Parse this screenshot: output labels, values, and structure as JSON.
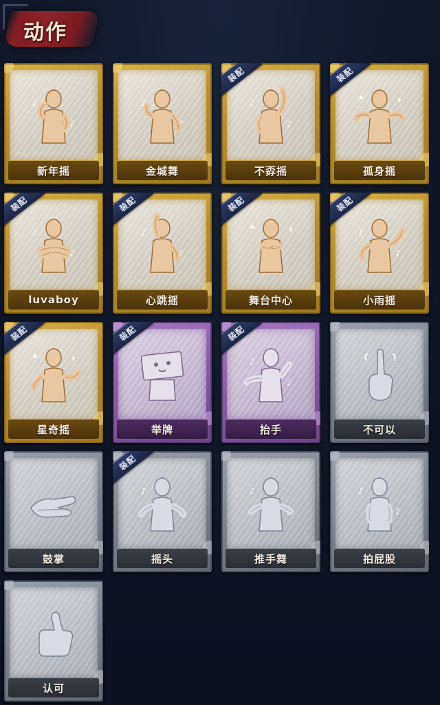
{
  "header": {
    "title": "动作"
  },
  "equip_badge_text": "装配",
  "colors": {
    "gold": "#c9a03a",
    "purple": "#8a5ea8",
    "gray": "#7c838f",
    "badge": "#24305a",
    "background": "#0d1322"
  },
  "cards": [
    {
      "label": "新年摇",
      "rarity": "gold",
      "equipped": false,
      "icon": "figure-wave-icon"
    },
    {
      "label": "金城舞",
      "rarity": "gold",
      "equipped": false,
      "icon": "figure-dance-icon"
    },
    {
      "label": "不孬摇",
      "rarity": "gold",
      "equipped": true,
      "icon": "figure-point-up-icon"
    },
    {
      "label": "孤身摇",
      "rarity": "gold",
      "equipped": true,
      "icon": "figure-arms-out-icon"
    },
    {
      "label": "luvaboy",
      "rarity": "gold",
      "equipped": true,
      "icon": "figure-cross-arms-icon"
    },
    {
      "label": "心跳摇",
      "rarity": "gold",
      "equipped": true,
      "icon": "figure-raise-hand-icon"
    },
    {
      "label": "舞台中心",
      "rarity": "gold",
      "equipped": true,
      "icon": "figure-hands-chest-icon"
    },
    {
      "label": "小雨摇",
      "rarity": "gold",
      "equipped": true,
      "icon": "figure-sway-icon"
    },
    {
      "label": "星奇摇",
      "rarity": "gold",
      "equipped": true,
      "icon": "figure-star-icon"
    },
    {
      "label": "举牌",
      "rarity": "purple",
      "equipped": true,
      "icon": "figure-hold-sign-icon"
    },
    {
      "label": "抬手",
      "rarity": "purple",
      "equipped": true,
      "icon": "figure-reach-icon"
    },
    {
      "label": "不可以",
      "rarity": "gray",
      "equipped": false,
      "icon": "finger-wag-icon"
    },
    {
      "label": "鼓掌",
      "rarity": "gray",
      "equipped": false,
      "icon": "clapping-hands-icon"
    },
    {
      "label": "摇头",
      "rarity": "gray",
      "equipped": true,
      "icon": "figure-shake-head-icon"
    },
    {
      "label": "推手舞",
      "rarity": "gray",
      "equipped": false,
      "icon": "figure-push-hands-icon"
    },
    {
      "label": "拍屁股",
      "rarity": "gray",
      "equipped": false,
      "icon": "figure-slap-icon"
    },
    {
      "label": "认可",
      "rarity": "gray",
      "equipped": false,
      "icon": "thumbs-up-icon"
    }
  ]
}
